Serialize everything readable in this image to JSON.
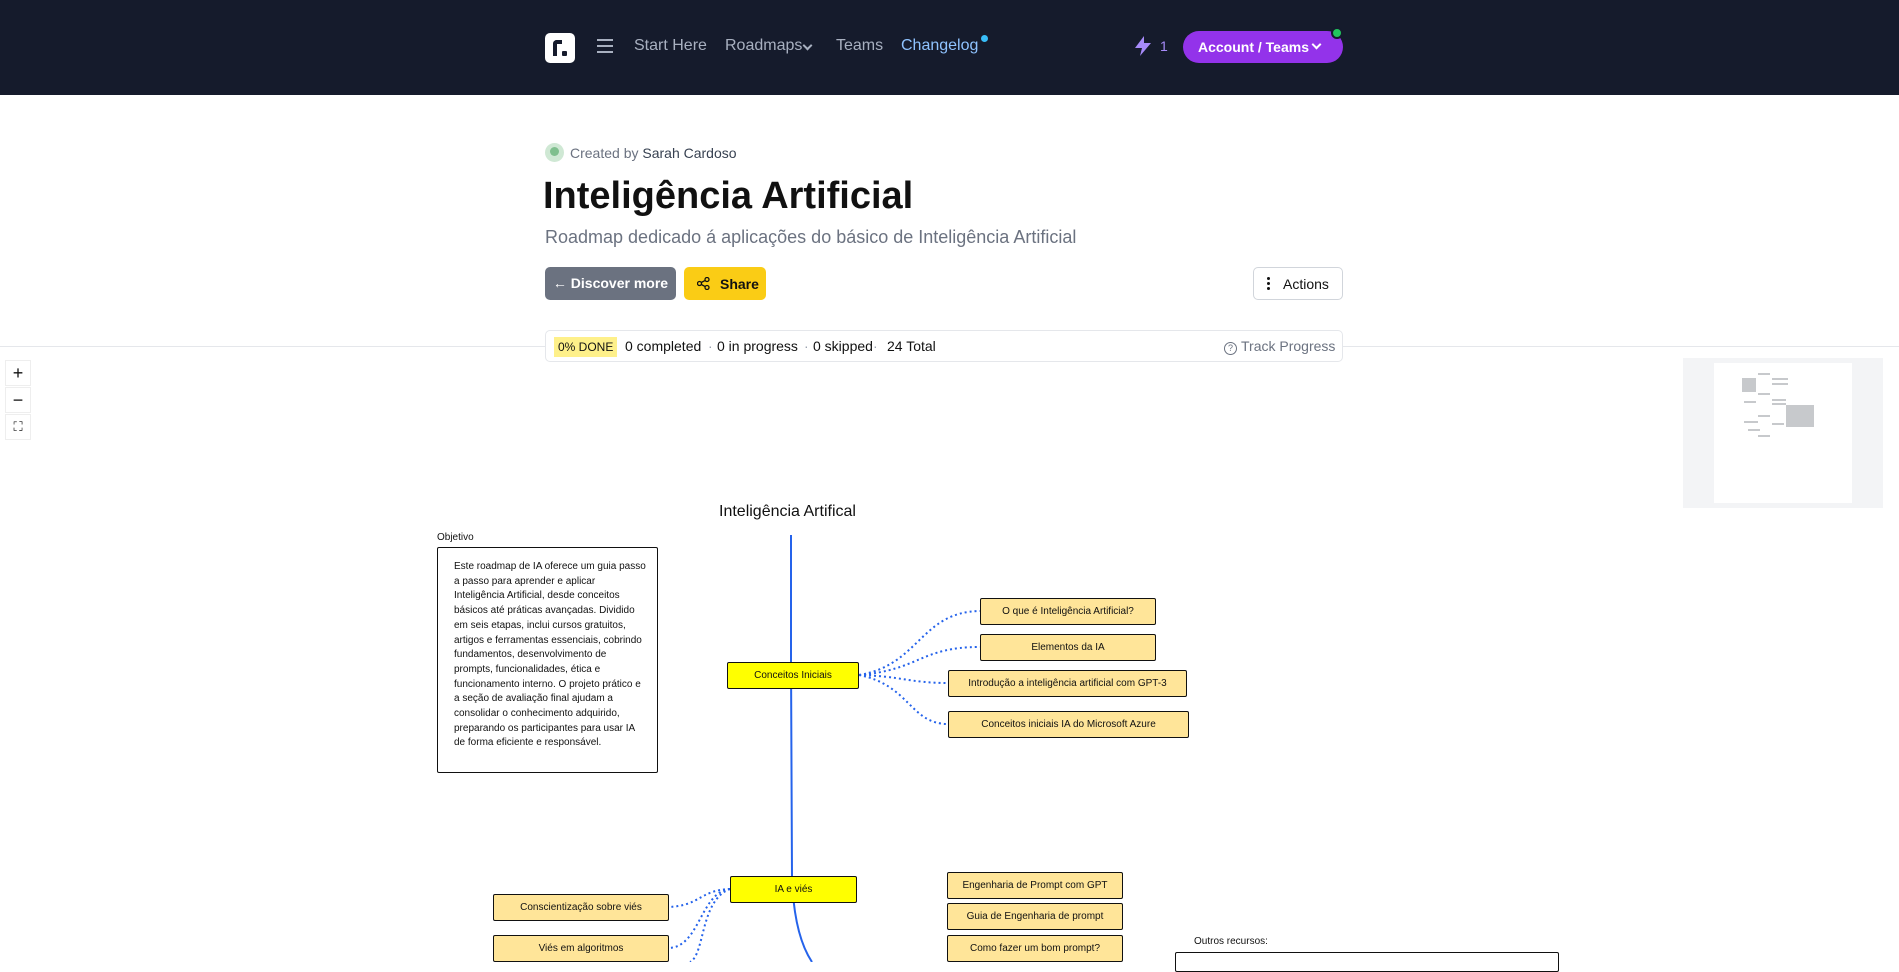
{
  "nav": {
    "links": [
      "Start Here",
      "Roadmaps",
      "Teams",
      "Changelog"
    ],
    "streak_count": "1",
    "account_label": "Account / Teams"
  },
  "header": {
    "created_by_prefix": "Created by",
    "author": "Sarah Cardoso",
    "title": "Inteligência Artificial",
    "subtitle": "Roadmap dedicado á aplicações do básico de Inteligência Artificial",
    "discover_label": "← Discover more",
    "share_label": "Share",
    "actions_label": "Actions"
  },
  "progress": {
    "done_badge": "0% DONE",
    "completed": "0 completed",
    "in_progress": "0 in progress",
    "skipped": "0 skipped",
    "total": "24 Total",
    "track_label": "Track Progress"
  },
  "zoom": {
    "in": "+",
    "out": "−",
    "fit": "⛶"
  },
  "roadmap": {
    "title": "Inteligência Artifical",
    "objective_label": "Objetivo",
    "objective_text": "Este roadmap de IA oferece um guia passo a passo para aprender e aplicar Inteligência Artificial, desde conceitos básicos até práticas avançadas. Dividido em seis etapas, inclui cursos gratuitos, artigos e ferramentas essenciais, cobrindo fundamentos, desenvolvimento de prompts, funcionalidades, ética e funcionamento interno. O projeto prático e a seção de avaliação final ajudam a consolidar o conhecimento adquirido, preparando os participantes para usar IA de forma eficiente e responsável.",
    "topics": [
      "Conceitos Iniciais",
      "IA e viés"
    ],
    "conceitos_subtopics": [
      "O que é Inteligência Artificial?",
      "Elementos da IA",
      "Introdução a inteligência artificial com GPT-3",
      "Conceitos iniciais IA do Microsoft Azure"
    ],
    "vies_subtopics": [
      "Conscientização sobre viés",
      "Viés em algoritmos"
    ],
    "prompt_subtopics": [
      "Engenharia de Prompt com GPT",
      "Guia de Engenharia de prompt",
      "Como fazer um bom prompt?"
    ],
    "other_resources_label": "Outros recursos:"
  },
  "colors": {
    "nav_bg": "#151b2c",
    "accent_purple": "#9333ea",
    "topic_yellow": "#ffff00",
    "subtopic_yellow": "#ffe599",
    "share_yellow": "#facc15",
    "connector_blue": "#2563eb"
  }
}
